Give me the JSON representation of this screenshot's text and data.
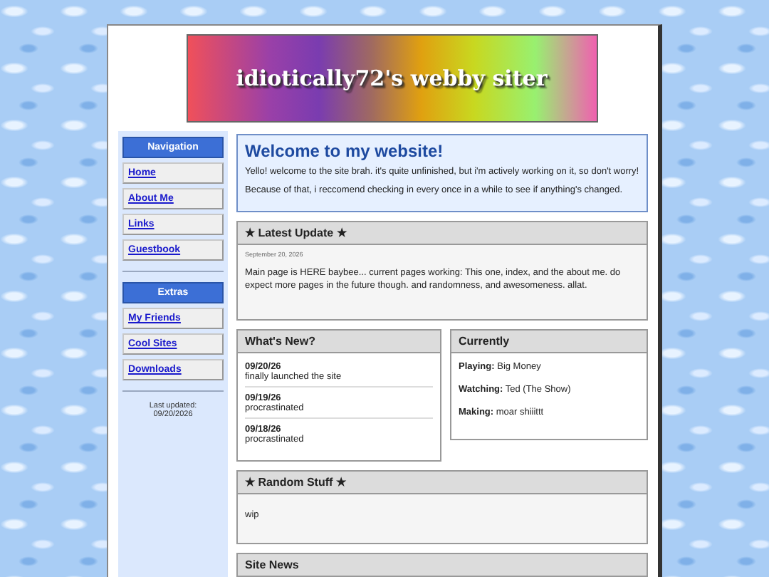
{
  "banner": {
    "title": "idiotically72's webby siter"
  },
  "sidebar": {
    "sections": [
      {
        "heading": "Navigation",
        "links": [
          "Home",
          "About Me",
          "Links",
          "Guestbook"
        ]
      },
      {
        "heading": "Extras",
        "links": [
          "My Friends",
          "Cool Sites",
          "Downloads"
        ]
      }
    ],
    "updated": [
      "Last updated:",
      "09/20/2026"
    ]
  },
  "welcome": {
    "heading": "Welcome to my website!",
    "paragraphs": [
      "Yello! welcome to the site brah. it's quite unfinished, but i'm actively working on it, so don't worry!",
      "Because of that, i reccomend checking in every once in a while to see if anything's changed."
    ]
  },
  "latest_update": {
    "heading": "★ Latest Update ★",
    "date": "September 20, 2026",
    "text": "Main page is HERE baybee... current pages working: This one, index, and the about me. do expect more pages in the future though. and randomness, and awesomeness. allat."
  },
  "whats_new": {
    "heading": "What's New?",
    "entries": [
      {
        "date": "09/20/26",
        "text": "finally launched the site"
      },
      {
        "date": "09/19/26",
        "text": "procrastinated"
      },
      {
        "date": "09/18/26",
        "text": "procrastinated"
      }
    ]
  },
  "currently": {
    "heading": "Currently",
    "items": [
      {
        "label": "Playing:",
        "value": "Big Money"
      },
      {
        "label": "Watching:",
        "value": "Ted (The Show)"
      },
      {
        "label": "Making:",
        "value": "moar shiiittt"
      }
    ]
  },
  "random_stuff": {
    "heading": "★ Random Stuff ★",
    "text": "wip"
  },
  "site_news": {
    "heading": "Site News"
  }
}
